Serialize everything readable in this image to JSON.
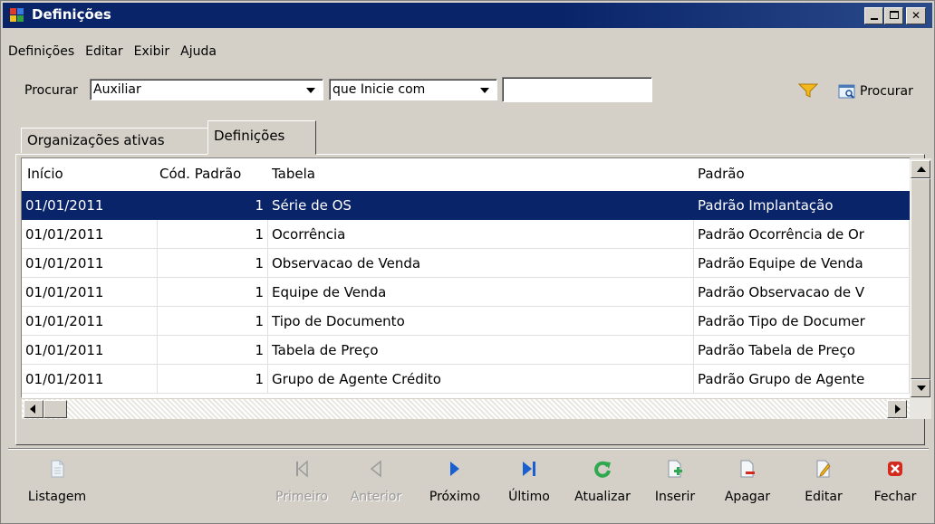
{
  "window": {
    "title": "Definições"
  },
  "menu": [
    "Definições",
    "Editar",
    "Exibir",
    "Ajuda"
  ],
  "search": {
    "label": "Procurar",
    "field_value": "Auxiliar",
    "condition_value": "que Inicie com",
    "text_value": "",
    "button_label": "Procurar"
  },
  "tabs": [
    {
      "label": "Organizações ativas",
      "active": false
    },
    {
      "label": "Definições",
      "active": true
    }
  ],
  "table": {
    "columns": [
      "Início",
      "Cód. Padrão",
      "Tabela",
      "Padrão"
    ],
    "rows": [
      {
        "inicio": "01/01/2011",
        "cod": "1",
        "tabela": "Série de OS",
        "padrao": "Padrão Implantação",
        "selected": true
      },
      {
        "inicio": "01/01/2011",
        "cod": "1",
        "tabela": "Ocorrência",
        "padrao": "Padrão Ocorrência de Or",
        "selected": false
      },
      {
        "inicio": "01/01/2011",
        "cod": "1",
        "tabela": "Observacao de Venda",
        "padrao": "Padrão Equipe de Venda",
        "selected": false
      },
      {
        "inicio": "01/01/2011",
        "cod": "1",
        "tabela": "Equipe de Venda",
        "padrao": "Padrão Observacao de V",
        "selected": false
      },
      {
        "inicio": "01/01/2011",
        "cod": "1",
        "tabela": "Tipo de Documento",
        "padrao": "Padrão Tipo de Documer",
        "selected": false
      },
      {
        "inicio": "01/01/2011",
        "cod": "1",
        "tabela": "Tabela de Preço",
        "padrao": "Padrão Tabela de Preço",
        "selected": false
      },
      {
        "inicio": "01/01/2011",
        "cod": "1",
        "tabela": "Grupo de Agente  Crédito",
        "padrao": "Padrão Grupo de Agente",
        "selected": false
      }
    ]
  },
  "toolbar": {
    "listagem": "Listagem",
    "primeiro": "Primeiro",
    "anterior": "Anterior",
    "proximo": "Próximo",
    "ultimo": "Último",
    "atualizar": "Atualizar",
    "inserir": "Inserir",
    "apagar": "Apagar",
    "editar": "Editar",
    "fechar": "Fechar"
  },
  "colors": {
    "titlebar": "#0a246a",
    "selection": "#0a246a",
    "nav_blue": "#1a5fd0",
    "refresh_green": "#2fa84f",
    "close_red": "#d42a1e"
  },
  "icons": {
    "filter": "filter-icon",
    "search": "search-icon",
    "listagem": "document-icon",
    "primeiro": "first-record-icon",
    "anterior": "previous-record-icon",
    "proximo": "next-record-icon",
    "ultimo": "last-record-icon",
    "atualizar": "refresh-icon",
    "inserir": "insert-icon",
    "apagar": "delete-icon",
    "editar": "edit-icon",
    "fechar": "close-icon"
  }
}
